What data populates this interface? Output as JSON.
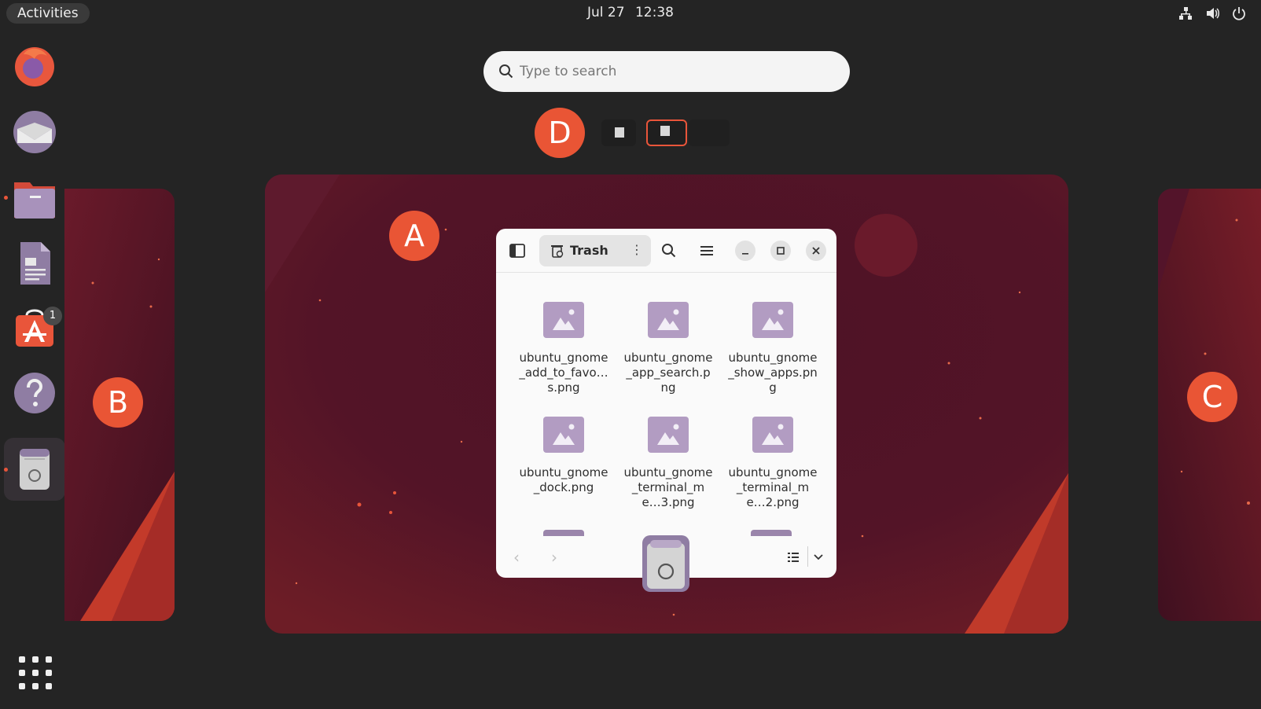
{
  "topbar": {
    "activities": "Activities",
    "date": "Jul 27",
    "time": "12:38",
    "tray_icons": [
      "network-icon",
      "volume-icon",
      "power-icon"
    ]
  },
  "dock": {
    "items": [
      "firefox",
      "thunderbird",
      "files",
      "libreoffice-writer",
      "app-center",
      "help",
      "trash"
    ],
    "app_center_badge": "1"
  },
  "search": {
    "placeholder": "Type to search"
  },
  "callouts": {
    "a": "A",
    "b": "B",
    "c": "C",
    "d": "D"
  },
  "window": {
    "title": "Trash",
    "files": [
      {
        "name": "ubuntu_gnome_add_to_favo… s.png"
      },
      {
        "name": "ubuntu_gnome_app_search.png"
      },
      {
        "name": "ubuntu_gnome_show_apps.png"
      },
      {
        "name": "ubuntu_gnome_dock.png"
      },
      {
        "name": "ubuntu_gnome_terminal_me…3.png"
      },
      {
        "name": "ubuntu_gnome_terminal_me…2.png"
      }
    ]
  },
  "colors": {
    "accent": "#e95535",
    "panel": "#242424",
    "wallpaper": "#4a1226"
  }
}
